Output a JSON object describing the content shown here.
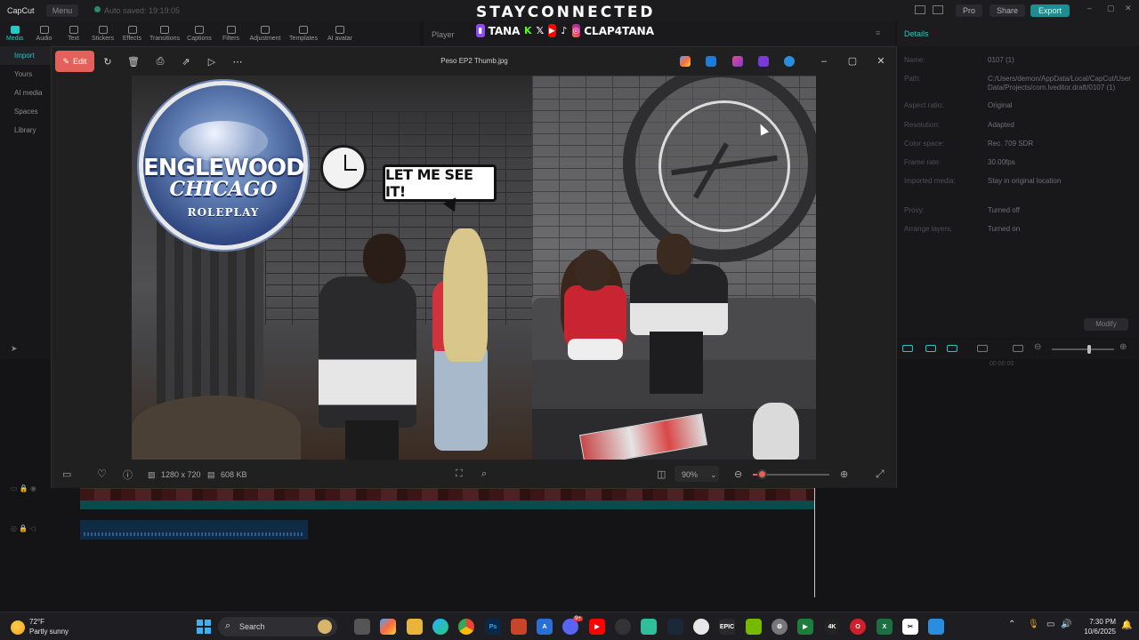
{
  "overlay": {
    "title": "STAYCONNECTED",
    "handle1": "TANA",
    "handle2": "CLAP4TANA"
  },
  "capcut": {
    "app_name": "CapCut",
    "menu": "Menu",
    "autosave": "Auto saved: 19:19:05",
    "pro": "Pro",
    "share": "Share",
    "export": "Export",
    "toolbar": [
      "Media",
      "Audio",
      "Text",
      "Stickers",
      "Effects",
      "Transitions",
      "Captions",
      "Filters",
      "Adjustment",
      "Templates",
      "AI avatar"
    ],
    "left_nav": [
      "Import",
      "Yours",
      "AI media",
      "Spaces",
      "Library"
    ],
    "player_label": "Player",
    "details": {
      "header": "Details",
      "rows": [
        {
          "label": "Name:",
          "value": "0107 (1)"
        },
        {
          "label": "Path:",
          "value": "C:/Users/demon/AppData/Local/CapCut/User Data/Projects/com.lveditor.draft/0107 (1)"
        },
        {
          "label": "Aspect ratio:",
          "value": "Original"
        },
        {
          "label": "Resolution:",
          "value": "Adapted"
        },
        {
          "label": "Color space:",
          "value": "Rec. 709 SDR"
        },
        {
          "label": "Frame rate:",
          "value": "30.00fps"
        },
        {
          "label": "Imported media:",
          "value": "Stay in original location"
        },
        {
          "label": "Proxy:",
          "value": "Turned off"
        },
        {
          "label": "Arrange layers:",
          "value": "Turned on"
        }
      ],
      "modify": "Modify"
    },
    "timecode": "00:00:00"
  },
  "photos": {
    "edit_label": "Edit",
    "filename": "Peso EP2 Thumb.jpg",
    "dimensions": "1280 x 720",
    "filesize": "608 KB",
    "zoom": "90%",
    "zoom_level": 0.12
  },
  "image": {
    "logo_line1": "ENGLEWOOD",
    "logo_line2": "CHICAGO",
    "logo_line3": "ROLEPLAY",
    "bubble": "LET ME SEE IT!"
  },
  "taskbar": {
    "temp": "72°F",
    "weather": "Partly sunny",
    "search_placeholder": "Search",
    "time": "7:30 PM",
    "date": "10/6/2025",
    "badge_count": "9+"
  }
}
